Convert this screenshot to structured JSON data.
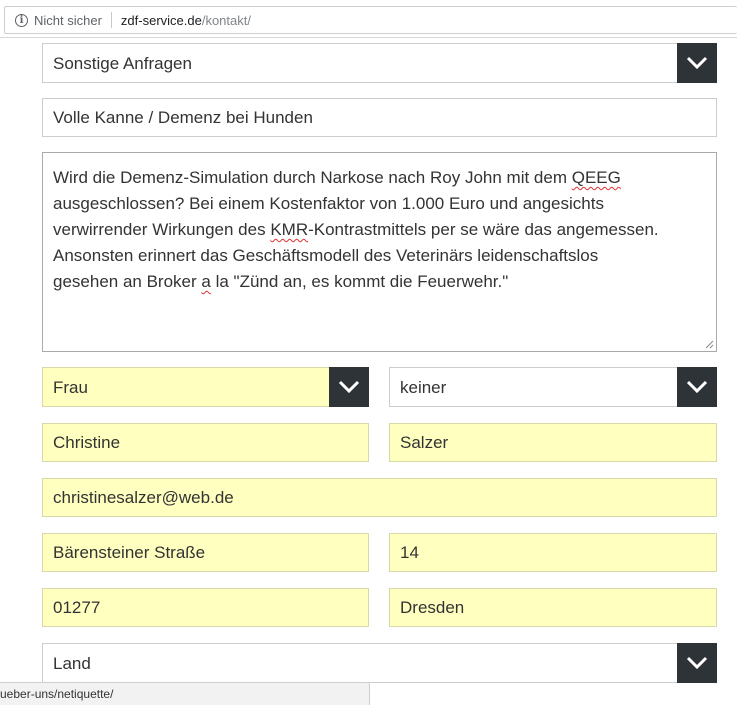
{
  "browser": {
    "security_label": "Nicht sicher",
    "url_host": "zdf-service.de",
    "url_path": "/kontakt/"
  },
  "form": {
    "category": {
      "value": "Sonstige Anfragen"
    },
    "subject": {
      "value": "Volle Kanne / Demenz bei Hunden"
    },
    "message": {
      "lines": [
        [
          "Wird die Demenz-Simulation durch Narkose nach Roy John mit dem ",
          "QEEG",
          ""
        ],
        [
          "ausgeschlossen? Bei einem Kostenfaktor von 1.000 Euro und angesichts",
          "",
          ""
        ],
        [
          "verwirrender Wirkungen des ",
          "KMR",
          "-Kontrastmittels per se wäre das angemessen."
        ],
        [
          "Ansonsten erinnert das Geschäftsmodell des Veterinärs leidenschaftslos",
          "",
          ""
        ],
        [
          "gesehen an Broker ",
          "a",
          " la \"Zünd an, es kommt die Feuerwehr.\""
        ]
      ]
    },
    "salutation": {
      "value": "Frau"
    },
    "title": {
      "value": "keiner"
    },
    "first_name": {
      "value": "Christine"
    },
    "last_name": {
      "value": "Salzer"
    },
    "email": {
      "value": "christinesalzer@web.de"
    },
    "street": {
      "value": "Bärensteiner Straße"
    },
    "house_number": {
      "value": "14"
    },
    "zip": {
      "value": "01277"
    },
    "city": {
      "value": "Dresden"
    },
    "country": {
      "value": "Land"
    }
  },
  "status_bar": {
    "url": "ueber-uns/netiquette/"
  },
  "colors": {
    "autofill_yellow": "#ffffc0",
    "select_arrow_bg": "#2e3338",
    "spellcheck_red": "#e03131"
  },
  "icons": {
    "info": "info-icon",
    "select": "chevron-down-icon",
    "resize": "resize-handle-icon"
  }
}
